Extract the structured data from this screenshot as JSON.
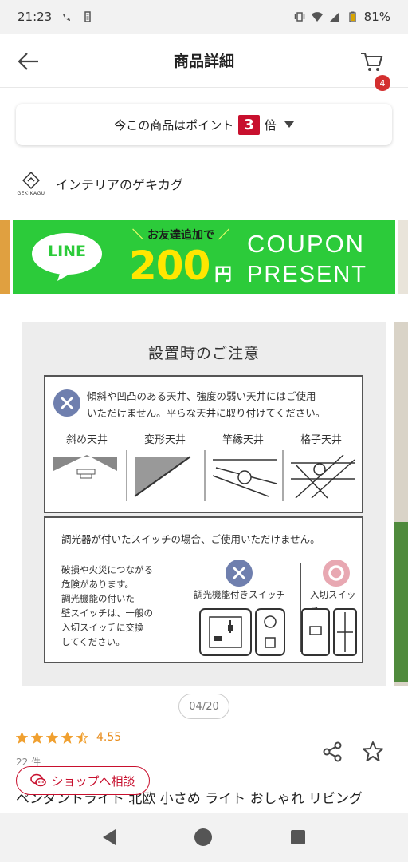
{
  "status_bar": {
    "time": "21:23",
    "battery": "81%"
  },
  "header": {
    "title": "商品詳細",
    "cart_count": "4"
  },
  "points": {
    "prefix": "今この商品はポイント",
    "multiplier": "3",
    "suffix": "倍"
  },
  "shop": {
    "logo_text": "GEKIKAGU",
    "name": "インテリアのゲキカグ"
  },
  "banner": {
    "line_logo": "LINE",
    "sub": "お友達追加で",
    "amount": "200",
    "currency": "円",
    "coupon": "COUPON",
    "present": "PRESENT",
    "colors": {
      "background": "#2ccb3a",
      "amount": "#ffe600"
    }
  },
  "product_image": {
    "title": "設置時のご注意",
    "panel1": {
      "warning": "傾斜や凹凸のある天井、強度の弱い天井にはご使用いただけません。平らな天井に取り付けてください。",
      "line1": "傾斜や凹凸のある天井、強度の弱い天井にはご使用",
      "line2": "いただけません。平らな天井に取り付けてください。",
      "cells": [
        "斜め天井",
        "変形天井",
        "竿縁天井",
        "格子天井"
      ]
    },
    "panel2": {
      "heading": "調光器が付いたスイッチの場合、ご使用いただけません。",
      "note_lines": [
        "破損や火災につながる",
        "危険があります。",
        "調光機能の付いた",
        "壁スイッチは、一般の",
        "入切スイッチに交換",
        "してください。"
      ],
      "ng_label": "調光機能付きスイッチ",
      "ok_label": "入切スイッチ"
    }
  },
  "pager": {
    "text": "04/20"
  },
  "rating": {
    "score": "4.55",
    "stars_value": 4.5,
    "stars_max": 5,
    "reviews": "22 件"
  },
  "product": {
    "name": "ペンダントライト 北欧 小さめ ライト おしゃれ リビング"
  },
  "consult_button": {
    "label": "ショップへ相談"
  }
}
